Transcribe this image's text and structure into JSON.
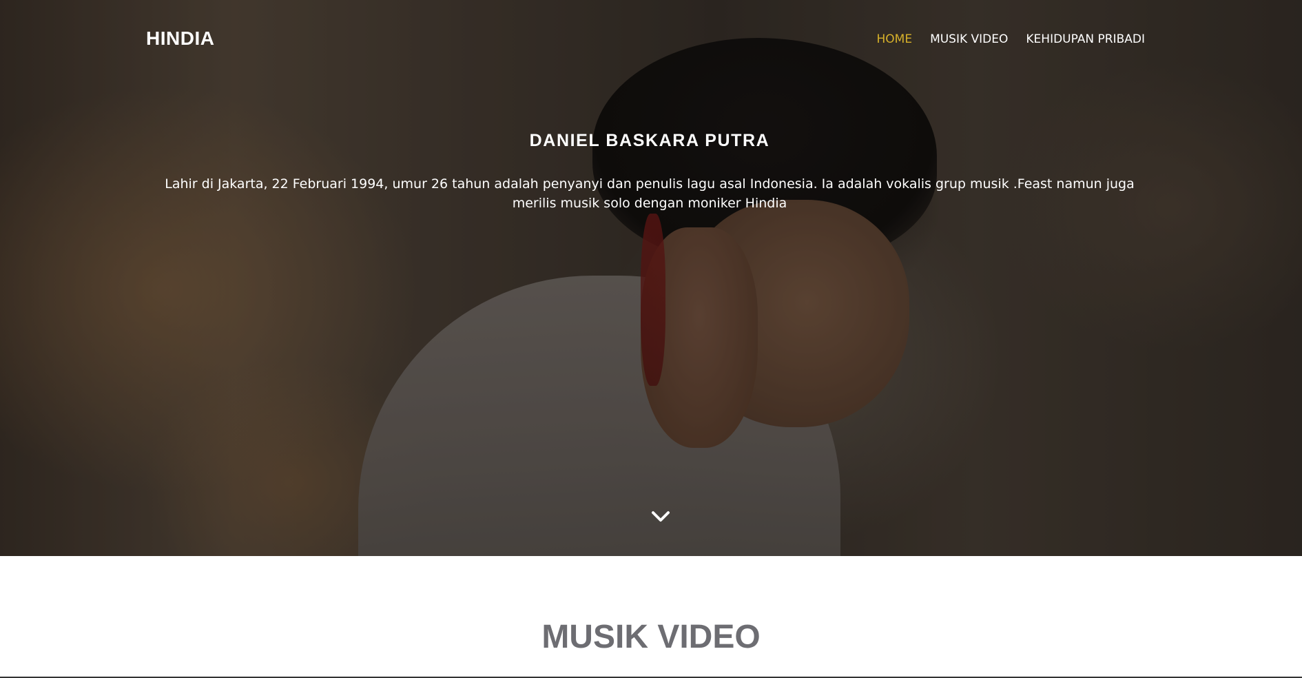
{
  "brand": "HINDIA",
  "nav": {
    "items": [
      {
        "label": "HOME",
        "active": true
      },
      {
        "label": "MUSIK VIDEO",
        "active": false
      },
      {
        "label": "KEHIDUPAN PRIBADI",
        "active": false
      }
    ],
    "active_color": "#d7b12a"
  },
  "hero": {
    "title": "DANIEL BASKARA PUTRA",
    "description": "Lahir di Jakarta, 22 Februari 1994, umur 26 tahun adalah penyanyi dan penulis lagu asal Indonesia. Ia adalah vokalis grup musik .Feast namun juga merilis musik solo dengan moniker Hindia",
    "scroll_icon": "chevron-down-icon"
  },
  "section": {
    "title": "MUSIK VIDEO"
  }
}
